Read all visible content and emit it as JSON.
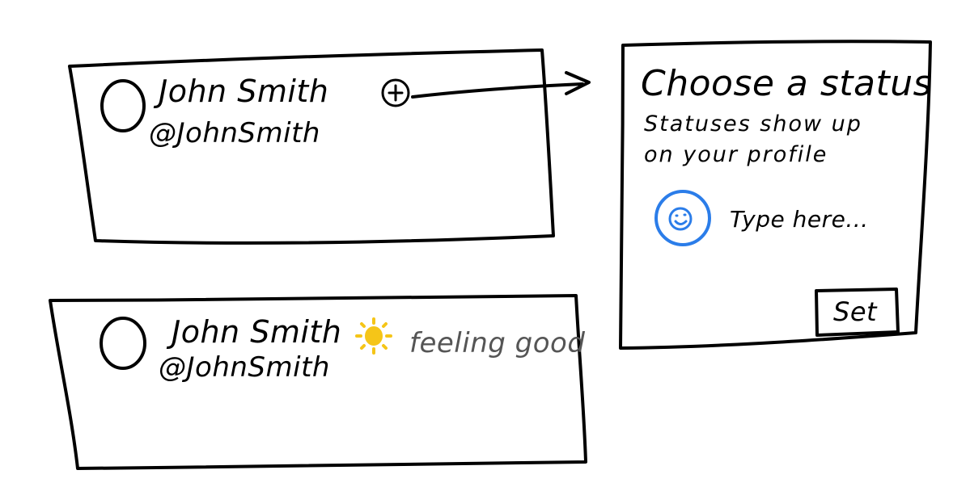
{
  "profile_card": {
    "name": "John Smith",
    "handle": "@JohnSmith",
    "add_status_icon": "plus-circle-icon"
  },
  "status_dialog": {
    "title": "Choose a status",
    "subtitle_line1": "Statuses show up",
    "subtitle_line2": "on your profile",
    "emoji_icon": "smiley-face-icon",
    "input_placeholder": "Type here...",
    "set_button_label": "Set"
  },
  "profile_card_with_status": {
    "name": "John Smith",
    "handle": "@JohnSmith",
    "status_icon": "sun-icon",
    "status_text": "feeling good"
  },
  "colors": {
    "ink": "#000000",
    "emoji_accent": "#2b7de9",
    "sun": "#f5c518",
    "status_text": "#555555"
  }
}
